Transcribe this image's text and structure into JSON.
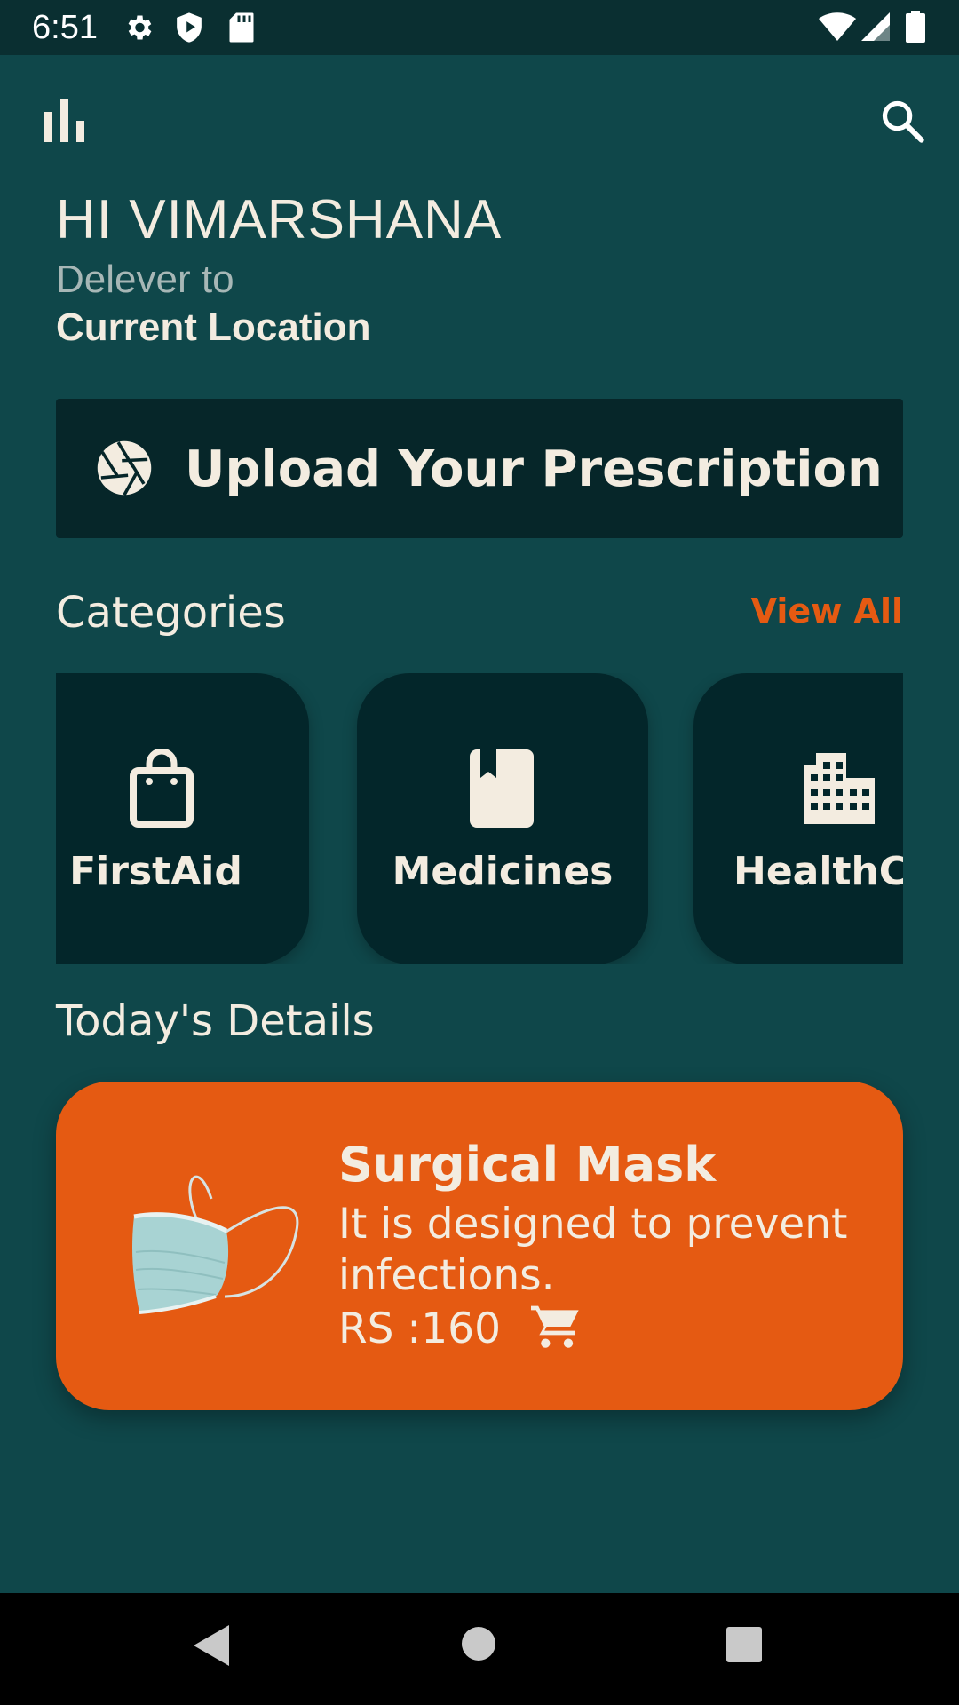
{
  "status_bar": {
    "time": "6:51",
    "left_icons": [
      "gear-icon",
      "shield-icon",
      "sd-card-icon"
    ],
    "right_icons": [
      "wifi-icon",
      "signal-icon",
      "battery-icon"
    ]
  },
  "top_bar": {
    "menu_icon": "bar-chart-icon",
    "search_icon": "search-icon"
  },
  "header": {
    "greeting": "HI VIMARSHANA",
    "deliver_label": "Delever to",
    "location": "Current Location"
  },
  "upload": {
    "icon": "camera-shutter-icon",
    "label": "Upload Your Prescription"
  },
  "categories": {
    "title": "Categories",
    "view_all": "View All",
    "items": [
      {
        "label": "FirstAid",
        "icon": "shopping-bag-icon"
      },
      {
        "label": "Medicines",
        "icon": "book-icon"
      },
      {
        "label": "HealthCa",
        "icon": "building-icon"
      }
    ]
  },
  "todays_details": {
    "title": "Today's Details",
    "product": {
      "name": "Surgical Mask",
      "description": "It is designed to prevent infections.",
      "price": "RS :160",
      "image": "surgical-mask-image",
      "cart_icon": "cart-icon"
    }
  },
  "colors": {
    "background": "#0f474a",
    "card_dark": "#03262a",
    "accent": "#e55a12",
    "text": "#f3ece0"
  },
  "nav_bar": {
    "buttons": [
      "back-icon",
      "home-icon",
      "recents-icon"
    ]
  }
}
